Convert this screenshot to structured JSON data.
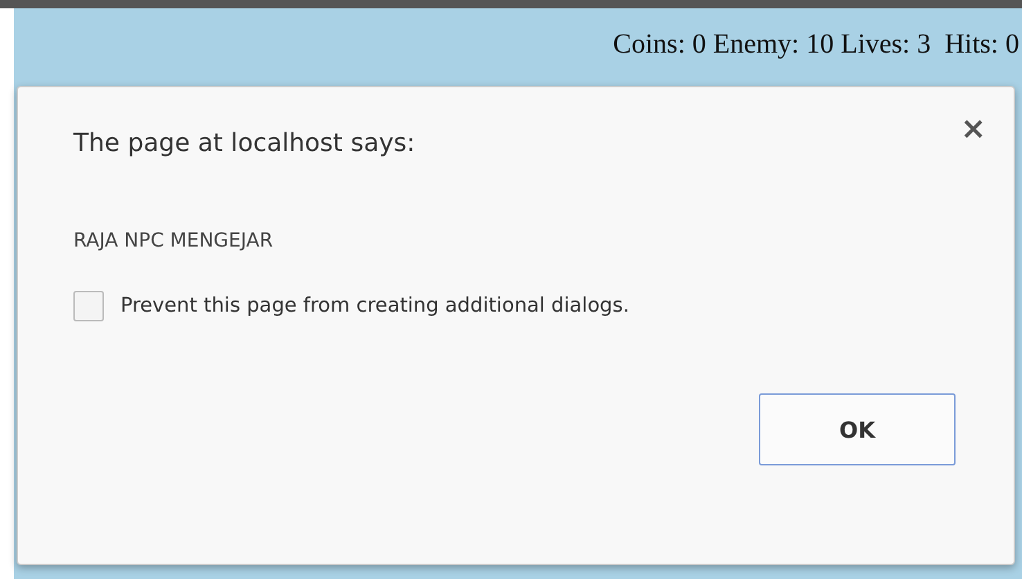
{
  "status_bar": {
    "text": "Coins: 0 Enemy: 10 Lives: 3  Hits: 0"
  },
  "dialog": {
    "title": "The page at localhost says:",
    "close": "×",
    "message": "RAJA NPC MENGEJAR",
    "checkbox": {
      "label": "Prevent this page from creating additional dialogs.",
      "checked": false
    },
    "buttons": [
      "OK"
    ]
  }
}
